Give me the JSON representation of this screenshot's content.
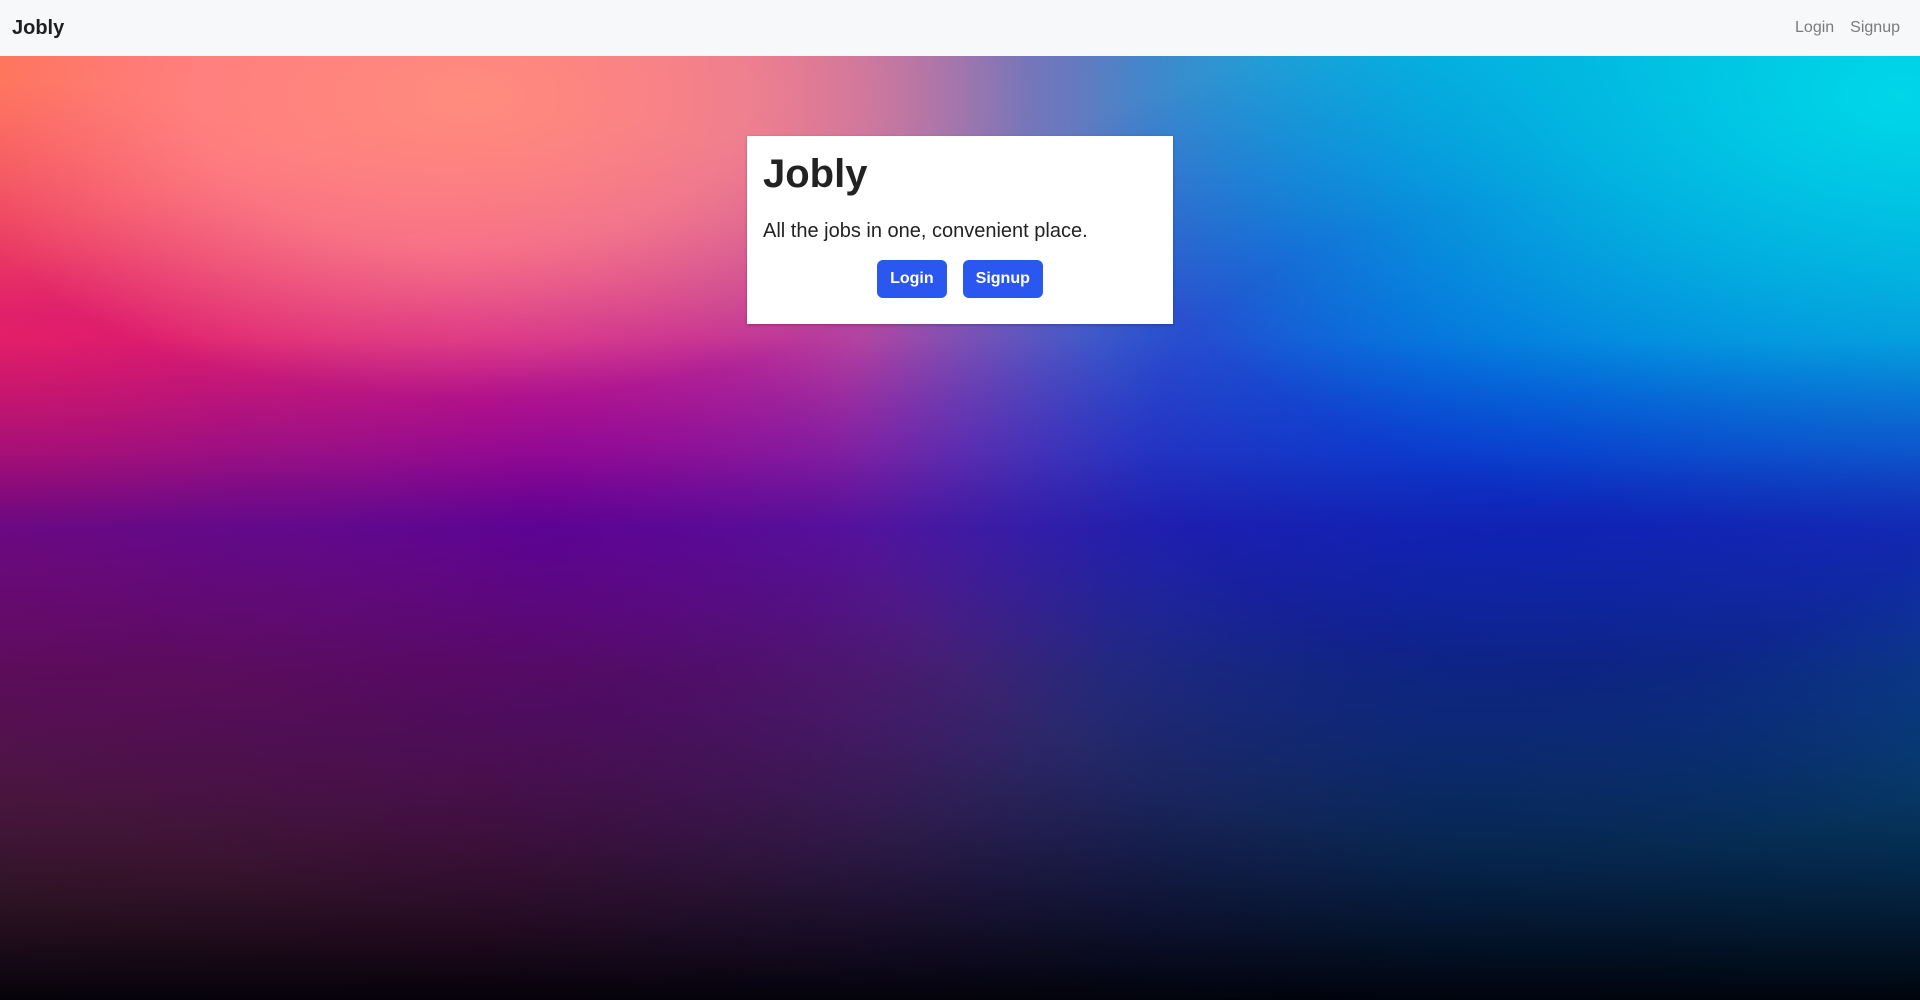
{
  "navbar": {
    "brand": "Jobly",
    "links": [
      "Login",
      "Signup"
    ]
  },
  "card": {
    "title": "Jobly",
    "lead": "All the jobs in one, convenient place.",
    "buttons": {
      "login": "Login",
      "signup": "Signup"
    }
  },
  "colors": {
    "navbar_bg": "#f7f8fa",
    "button_bg": "#2b57f1",
    "button_text": "#ffffff",
    "text": "#222222",
    "nav_link": "#7a7a7a"
  }
}
